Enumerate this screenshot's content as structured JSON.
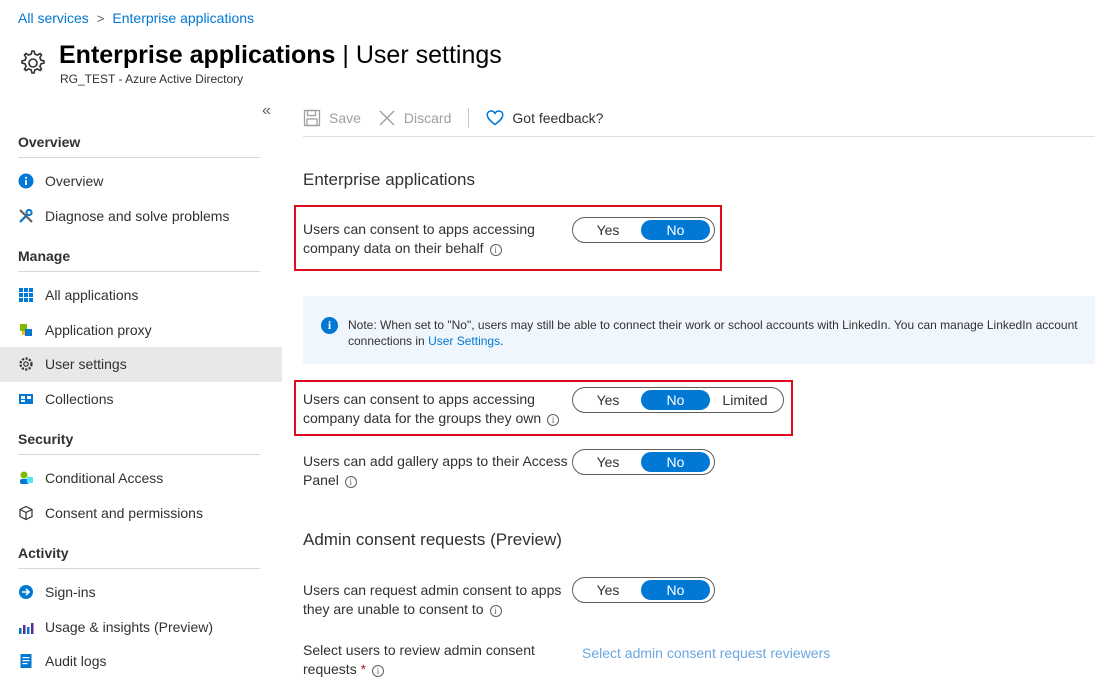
{
  "breadcrumb": {
    "items": [
      "All services",
      "Enterprise applications"
    ],
    "separator": ">"
  },
  "header": {
    "title_bold": "Enterprise applications",
    "title_sep": " | ",
    "title_rest": "User settings",
    "subtitle": "RG_TEST - Azure Active Directory"
  },
  "sidebar": {
    "collapse_label": "«",
    "sections": [
      {
        "title": "Overview",
        "items": [
          "Overview",
          "Diagnose and solve problems"
        ]
      },
      {
        "title": "Manage",
        "items": [
          "All applications",
          "Application proxy",
          "User settings",
          "Collections"
        ]
      },
      {
        "title": "Security",
        "items": [
          "Conditional Access",
          "Consent and permissions"
        ]
      },
      {
        "title": "Activity",
        "items": [
          "Sign-ins",
          "Usage & insights (Preview)",
          "Audit logs"
        ]
      }
    ],
    "active_item": "User settings"
  },
  "toolbar": {
    "save": "Save",
    "discard": "Discard",
    "feedback": "Got feedback?"
  },
  "sections": {
    "enterprise_apps": "Enterprise applications",
    "admin_consent": "Admin consent requests (Preview)"
  },
  "settings": {
    "consent_company": {
      "label": "Users can consent to apps accessing company data on their behalf",
      "yes": "Yes",
      "no": "No",
      "selected": "No"
    },
    "consent_groups": {
      "label": "Users can consent to apps accessing company data for the groups they own",
      "yes": "Yes",
      "no": "No",
      "limited": "Limited",
      "selected": "No"
    },
    "gallery_apps": {
      "label": "Users can add gallery apps to their Access Panel",
      "yes": "Yes",
      "no": "No",
      "selected": "No"
    },
    "admin_request": {
      "label": "Users can request admin consent to apps they are unable to consent to",
      "yes": "Yes",
      "no": "No",
      "selected": "No"
    },
    "reviewers": {
      "label": "Select users to review admin consent requests",
      "required": "*",
      "link": "Select admin consent request reviewers"
    }
  },
  "notice": {
    "text": "Note: When set to \"No\", users may still be able to connect their work or school accounts with LinkedIn. You can manage LinkedIn account connections in ",
    "link": "User Settings",
    "end": "."
  },
  "info_glyph": "i",
  "colors": {
    "accent": "#0078d4",
    "highlight_box": "#e00b1c",
    "notice_bg": "#f0f6fd"
  }
}
